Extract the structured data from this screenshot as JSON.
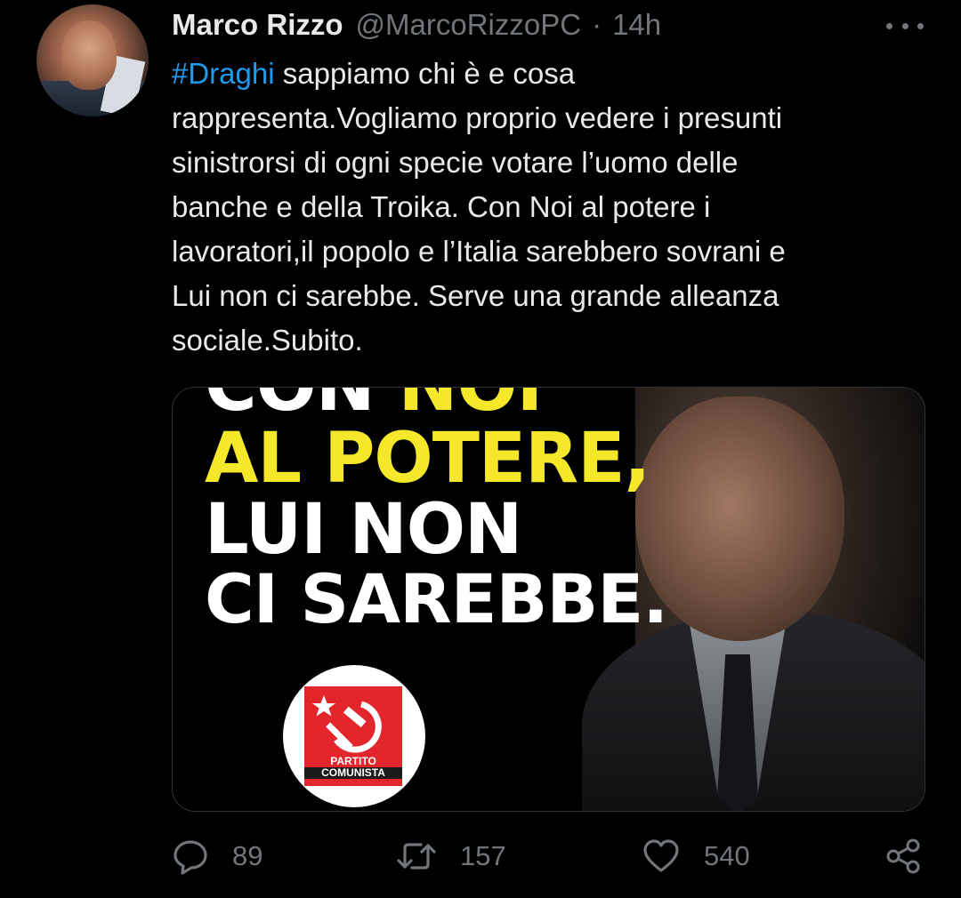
{
  "tweet": {
    "author_name": "Marco Rizzo",
    "author_handle": "@MarcoRizzoPC",
    "separator": "·",
    "time": "14h",
    "hashtag": "#Draghi",
    "body_lines": [
      " sappiamo chi è e cosa",
      "rappresenta.Vogliamo proprio vedere i presunti",
      "sinistrorsi di ogni specie votare l’uomo delle",
      "banche e della Troika. Con Noi al potere i",
      "lavoratori,il popolo e l’Italia sarebbero sovrani e",
      "Lui non ci sarebbe. Serve una grande alleanza",
      "sociale.Subito."
    ]
  },
  "media": {
    "slogan_line1_white": "CON ",
    "slogan_line1_yellow": "NOI",
    "slogan_line2": "AL POTERE,",
    "slogan_line3": "LUI NON",
    "slogan_line4": "CI SAREBBE.",
    "logo_text_line1": "PARTITO",
    "logo_text_line2": "COMUNISTA",
    "colors": {
      "slogan_yellow": "#f5e82a",
      "logo_red": "#e3262b"
    }
  },
  "actions": {
    "reply_count": "89",
    "retweet_count": "157",
    "like_count": "540"
  },
  "icons": {
    "more": "more-dots-icon",
    "reply": "speech-bubble-icon",
    "retweet": "retweet-arrows-icon",
    "like": "heart-icon",
    "share": "share-icon"
  },
  "colors": {
    "background": "#000000",
    "text": "#e7e9ea",
    "muted": "#71767b",
    "link": "#1d9bf0"
  }
}
